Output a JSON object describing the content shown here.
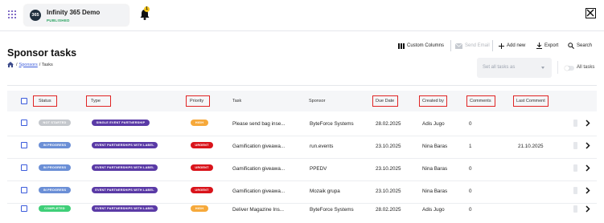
{
  "app": {
    "logo_text": "365",
    "name": "Infinity 365 Demo",
    "status": "PUBLISHED",
    "notification_count": "1"
  },
  "page": {
    "title": "Sponsor tasks",
    "breadcrumb": [
      "/",
      "Sponsors",
      "/ Tasks"
    ]
  },
  "toolbar": {
    "custom_columns": "Custom Columns",
    "send_email": "Send Email",
    "add_new": "Add new",
    "export": "Export",
    "search": "Search"
  },
  "filters": {
    "view_select": "Set all tasks as",
    "all_tasks_label": "All tasks"
  },
  "table": {
    "columns": [
      "Status",
      "Type",
      "Priority",
      "Task",
      "Sponsor",
      "Due Date",
      "Created by",
      "Comments",
      "Last Comment"
    ],
    "rows": [
      {
        "status": "NOT STARTED",
        "type": "SINGLE EVENT PARTNERSHIP",
        "priority": "HIGH",
        "task": "Please send bag inse...",
        "sponsor": "ByteForce Systems",
        "due_date": "28.02.2025",
        "created_by": "Adis Jugo",
        "comments": "0",
        "last_comment": ""
      },
      {
        "status": "IN PROGRESS",
        "type": "EVENT PARTNERSHIPS WITH LABEL",
        "priority": "URGENT",
        "task": "Gamification giveawa...",
        "sponsor": "run.events",
        "due_date": "23.10.2025",
        "created_by": "Nina Baras",
        "comments": "1",
        "last_comment": "21.10.2025"
      },
      {
        "status": "IN PROGRESS",
        "type": "EVENT PARTNERSHIPS WITH LABEL",
        "priority": "URGENT",
        "task": "Gamification giveawa...",
        "sponsor": "PPEDV",
        "due_date": "23.10.2025",
        "created_by": "Nina Baras",
        "comments": "0",
        "last_comment": ""
      },
      {
        "status": "IN PROGRESS",
        "type": "EVENT PARTNERSHIPS WITH LABEL",
        "priority": "URGENT",
        "task": "Gamification giveawa...",
        "sponsor": "Mozaik grupa",
        "due_date": "23.10.2025",
        "created_by": "Nina Baras",
        "comments": "0",
        "last_comment": ""
      },
      {
        "status": "COMPLETED",
        "type": "EVENT PARTNERSHIPS WITH LABEL",
        "priority": "HIGH",
        "task": "Deliver Magazine Ins...",
        "sponsor": "ByteForce Systems",
        "due_date": "28.02.2025",
        "created_by": "Adis Jugo",
        "comments": "0",
        "last_comment": ""
      }
    ]
  },
  "colors": {
    "status": {
      "NOT STARTED": "#c4c7cc",
      "IN PROGRESS": "#6b8fd6",
      "COMPLETED": "#3fcf78"
    },
    "type": "#5a3aa6",
    "priority": {
      "HIGH": "#f6a93b",
      "URGENT": "#d9141b"
    },
    "highlight": "#e02424",
    "accent": "#3b5bdb"
  }
}
